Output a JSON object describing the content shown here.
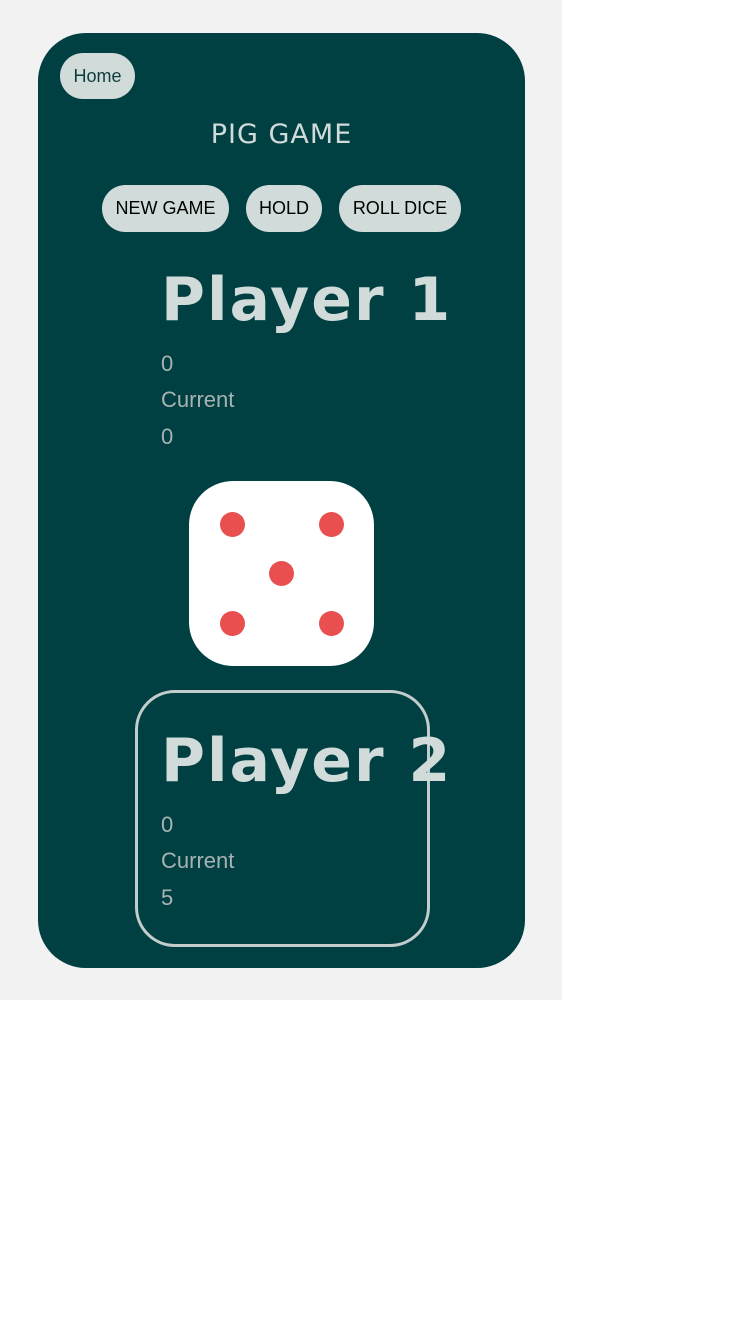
{
  "nav": {
    "home_label": "Home"
  },
  "title": "PIG GAME",
  "controls": {
    "new_game_label": "NEW GAME",
    "hold_label": "HOLD",
    "roll_dice_label": "ROLL DICE"
  },
  "players": [
    {
      "name": "Player 1",
      "score": "0",
      "current_label": "Current",
      "current": "0",
      "active": false
    },
    {
      "name": "Player 2",
      "score": "0",
      "current_label": "Current",
      "current": "5",
      "active": true
    }
  ],
  "dice": {
    "value": 5,
    "pip_color": "#e94f4f"
  },
  "colors": {
    "card_background": "#004043",
    "button_background": "#d1dbd9",
    "page_background": "#f2f2f2"
  }
}
